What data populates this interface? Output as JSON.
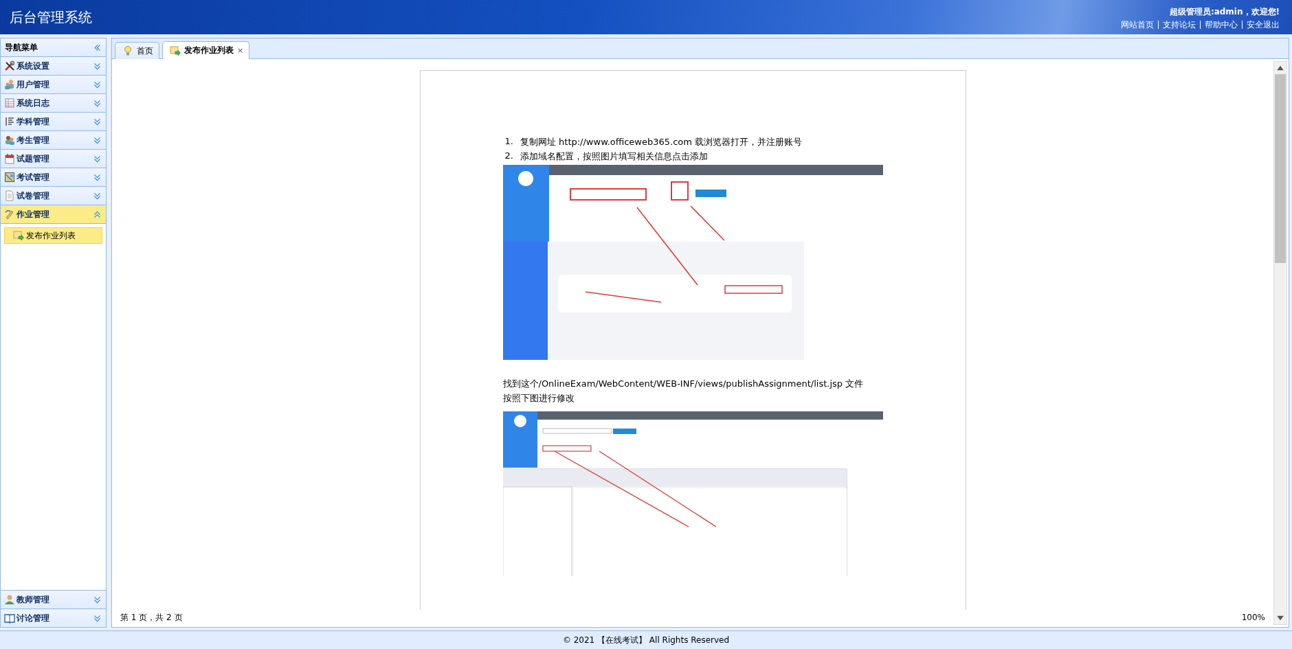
{
  "header": {
    "title": "后台管理系统",
    "greeting": "超级管理员:admin，欢迎您!",
    "links": [
      "网站首页",
      "支持论坛",
      "帮助中心",
      "安全退出"
    ]
  },
  "sidebar": {
    "title": "导航菜单",
    "sections": [
      {
        "label": "系统设置",
        "expanded": false
      },
      {
        "label": "用户管理",
        "expanded": false
      },
      {
        "label": "系统日志",
        "expanded": false
      },
      {
        "label": "学科管理",
        "expanded": false
      },
      {
        "label": "考生管理",
        "expanded": false
      },
      {
        "label": "试题管理",
        "expanded": false
      },
      {
        "label": "考试管理",
        "expanded": false
      },
      {
        "label": "试卷管理",
        "expanded": false
      },
      {
        "label": "作业管理",
        "expanded": true,
        "children": [
          {
            "label": "发布作业列表",
            "selected": true
          }
        ]
      },
      {
        "label": "教师管理",
        "expanded": false
      },
      {
        "label": "讨论管理",
        "expanded": false
      }
    ]
  },
  "tabs": [
    {
      "label": "首页",
      "selected": false
    },
    {
      "label": "发布作业列表",
      "selected": true,
      "close": "×"
    }
  ],
  "document": {
    "blocks": [
      {
        "kind": "list",
        "items": [
          {
            "number": "1.",
            "text": "复制网址 http://www.officeweb365.com 载浏览器打开，并注册账号"
          },
          {
            "number": "2.",
            "text": "添加域名配置，按照图片填写相关信息点击添加"
          }
        ]
      },
      {
        "kind": "picture"
      },
      {
        "kind": "para",
        "lines": [
          "找到这个/OnlineExam/WebContent/WEB-INF/views/publishAssignment/list.jsp 文件",
          "按照下图进行修改"
        ]
      },
      {
        "kind": "picture"
      }
    ]
  },
  "viewer": {
    "page_info": "第 1 页，共 2 页",
    "zoom": "100%"
  },
  "footer": "© 2021 【在线考试】 All Rights Reserved"
}
